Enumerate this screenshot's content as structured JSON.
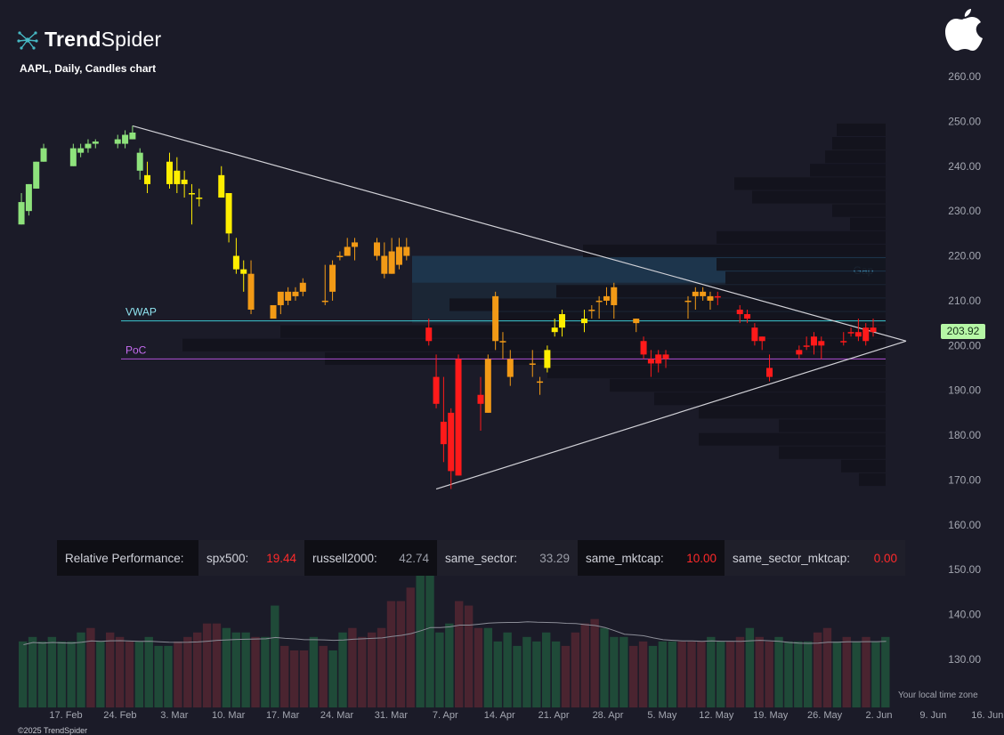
{
  "header": {
    "brand_bold": "Trend",
    "brand_light": "Spider",
    "subtitle": "AAPL, Daily, Candles chart",
    "copyright": "©2025 TrendSpider",
    "timezone_note": "Your local time zone"
  },
  "last_price": "203.92",
  "colors": {
    "background": "#1b1b28",
    "bull_strong": "#8ee27c",
    "neutral_yellow": "#ffee00",
    "bear_orange": "#f29a16",
    "bear_red": "#ff1a1a",
    "vwap": "#3cc8d2",
    "poc": "#b04fd6",
    "gap_zone": "#1f3f58",
    "trendline": "#d2d2d8",
    "volume_green": "#1f4a38",
    "volume_red": "#4a2430"
  },
  "performance": {
    "title": "Relative Performance:",
    "items": [
      {
        "label": "spx500:",
        "value": "19.44",
        "tone": "red",
        "bg": "light"
      },
      {
        "label": "russell2000:",
        "value": "42.74",
        "tone": "grey",
        "bg": "dark"
      },
      {
        "label": "same_sector:",
        "value": "33.29",
        "tone": "grey",
        "bg": "light"
      },
      {
        "label": "same_mktcap:",
        "value": "10.00",
        "tone": "red",
        "bg": "dark"
      },
      {
        "label": "same_sector_mktcap:",
        "value": "0.00",
        "tone": "red",
        "bg": "light"
      }
    ]
  },
  "chart_data": {
    "type": "candlestick",
    "symbol": "AAPL",
    "interval": "Daily",
    "y_axis": {
      "ticks": [
        "260.00",
        "250.00",
        "240.00",
        "230.00",
        "220.00",
        "210.00",
        "200.00",
        "190.00",
        "180.00",
        "170.00",
        "160.00",
        "150.00",
        "140.00",
        "130.00"
      ],
      "range": [
        130,
        260
      ]
    },
    "x_axis": {
      "ticks": [
        "17. Feb",
        "24. Feb",
        "3. Mar",
        "10. Mar",
        "17. Mar",
        "24. Mar",
        "31. Mar",
        "7. Apr",
        "14. Apr",
        "21. Apr",
        "28. Apr",
        "5. May",
        "12. May",
        "19. May",
        "26. May",
        "2. Jun",
        "9. Jun",
        "16. Jun"
      ]
    },
    "candles": [
      {
        "date": "2025-02-11",
        "o": 227,
        "h": 234,
        "l": 227,
        "c": 232,
        "col": "green"
      },
      {
        "date": "2025-02-12",
        "o": 230,
        "h": 236,
        "l": 229,
        "c": 236,
        "col": "green"
      },
      {
        "date": "2025-02-13",
        "o": 235,
        "h": 241,
        "l": 235,
        "c": 241,
        "col": "green"
      },
      {
        "date": "2025-02-14",
        "o": 241,
        "h": 245,
        "l": 241,
        "c": 244,
        "col": "green"
      },
      {
        "date": "2025-02-18",
        "o": 240,
        "h": 245,
        "l": 240,
        "c": 244,
        "col": "green"
      },
      {
        "date": "2025-02-19",
        "o": 243,
        "h": 245,
        "l": 242,
        "c": 244,
        "col": "green"
      },
      {
        "date": "2025-02-20",
        "o": 244,
        "h": 246,
        "l": 243,
        "c": 245,
        "col": "green"
      },
      {
        "date": "2025-02-21",
        "o": 245,
        "h": 246,
        "l": 244,
        "c": 245.5,
        "col": "green"
      },
      {
        "date": "2025-02-24",
        "o": 245,
        "h": 247,
        "l": 244,
        "c": 246,
        "col": "green"
      },
      {
        "date": "2025-02-25",
        "o": 245,
        "h": 248,
        "l": 244,
        "c": 247,
        "col": "green"
      },
      {
        "date": "2025-02-26",
        "o": 246,
        "h": 249,
        "l": 246,
        "c": 247.5,
        "col": "green"
      },
      {
        "date": "2025-02-27",
        "o": 243,
        "h": 244,
        "l": 237,
        "c": 239,
        "col": "green"
      },
      {
        "date": "2025-02-28",
        "o": 236,
        "h": 241,
        "l": 234,
        "c": 238,
        "col": "yellow"
      },
      {
        "date": "2025-03-03",
        "o": 241,
        "h": 243,
        "l": 235,
        "c": 236,
        "col": "yellow"
      },
      {
        "date": "2025-03-04",
        "o": 236,
        "h": 242,
        "l": 234,
        "c": 239,
        "col": "yellow"
      },
      {
        "date": "2025-03-05",
        "o": 237,
        "h": 239,
        "l": 233,
        "c": 236,
        "col": "yellow"
      },
      {
        "date": "2025-03-06",
        "o": 234,
        "h": 236,
        "l": 227,
        "c": 234,
        "col": "yellow"
      },
      {
        "date": "2025-03-07",
        "o": 233,
        "h": 235,
        "l": 231,
        "c": 233,
        "col": "yellow"
      },
      {
        "date": "2025-03-10",
        "o": 233,
        "h": 240,
        "l": 233,
        "c": 238,
        "col": "yellow"
      },
      {
        "date": "2025-03-11",
        "o": 234,
        "h": 234,
        "l": 223,
        "c": 225,
        "col": "yellow"
      },
      {
        "date": "2025-03-12",
        "o": 220,
        "h": 224,
        "l": 216,
        "c": 217,
        "col": "yellow"
      },
      {
        "date": "2025-03-13",
        "o": 217,
        "h": 219,
        "l": 212,
        "c": 216,
        "col": "yellow"
      },
      {
        "date": "2025-03-14",
        "o": 216,
        "h": 219,
        "l": 207,
        "c": 208,
        "col": "orange"
      },
      {
        "date": "2025-03-17",
        "o": 206,
        "h": 209,
        "l": 207,
        "c": 209,
        "col": "orange"
      },
      {
        "date": "2025-03-18",
        "o": 209,
        "h": 211,
        "l": 207,
        "c": 212,
        "col": "orange"
      },
      {
        "date": "2025-03-19",
        "o": 210,
        "h": 213,
        "l": 209,
        "c": 212,
        "col": "orange"
      },
      {
        "date": "2025-03-20",
        "o": 212,
        "h": 213,
        "l": 210,
        "c": 211,
        "col": "orange"
      },
      {
        "date": "2025-03-21",
        "o": 212,
        "h": 215,
        "l": 211,
        "c": 214,
        "col": "orange"
      },
      {
        "date": "2025-03-24",
        "o": 210,
        "h": 218,
        "l": 209,
        "c": 210,
        "col": "orange"
      },
      {
        "date": "2025-03-25",
        "o": 212,
        "h": 219,
        "l": 210,
        "c": 218,
        "col": "orange"
      },
      {
        "date": "2025-03-26",
        "o": 220,
        "h": 221,
        "l": 219,
        "c": 220,
        "col": "orange"
      },
      {
        "date": "2025-03-27",
        "o": 220,
        "h": 224,
        "l": 220,
        "c": 222,
        "col": "orange"
      },
      {
        "date": "2025-03-28",
        "o": 222,
        "h": 224,
        "l": 219,
        "c": 223,
        "col": "orange"
      },
      {
        "date": "2025-03-31",
        "o": 223,
        "h": 224,
        "l": 219,
        "c": 220,
        "col": "orange"
      },
      {
        "date": "2025-04-01",
        "o": 216,
        "h": 223,
        "l": 215,
        "c": 220,
        "col": "orange"
      },
      {
        "date": "2025-04-02",
        "o": 221,
        "h": 224,
        "l": 216,
        "c": 216,
        "col": "orange"
      },
      {
        "date": "2025-04-03",
        "o": 218,
        "h": 224,
        "l": 217,
        "c": 222,
        "col": "orange"
      },
      {
        "date": "2025-04-04",
        "o": 220,
        "h": 224,
        "l": 219,
        "c": 222,
        "col": "orange"
      },
      {
        "date": "2025-04-07",
        "o": 204,
        "h": 206,
        "l": 200,
        "c": 201,
        "col": "red"
      },
      {
        "date": "2025-04-08",
        "o": 193,
        "h": 198,
        "l": 186,
        "c": 187,
        "col": "red"
      },
      {
        "date": "2025-04-09",
        "o": 183,
        "h": 193,
        "l": 174,
        "c": 178,
        "col": "red"
      },
      {
        "date": "2025-04-10",
        "o": 185,
        "h": 186,
        "l": 168,
        "c": 172,
        "col": "red"
      },
      {
        "date": "2025-04-11",
        "o": 197,
        "h": 198,
        "l": 171,
        "c": 171,
        "col": "red"
      },
      {
        "date": "2025-04-14",
        "o": 189,
        "h": 193,
        "l": 181,
        "c": 187,
        "col": "red"
      },
      {
        "date": "2025-04-15",
        "o": 185,
        "h": 198,
        "l": 185,
        "c": 197,
        "col": "orange"
      },
      {
        "date": "2025-04-16",
        "o": 201,
        "h": 212,
        "l": 199,
        "c": 211,
        "col": "orange"
      },
      {
        "date": "2025-04-17",
        "o": 201,
        "h": 203,
        "l": 197,
        "c": 201,
        "col": "orange"
      },
      {
        "date": "2025-04-18",
        "o": 193,
        "h": 199,
        "l": 191,
        "c": 197,
        "col": "orange"
      },
      {
        "date": "2025-04-21",
        "o": 196,
        "h": 199,
        "l": 193,
        "c": 196,
        "col": "orange"
      },
      {
        "date": "2025-04-22",
        "o": 192,
        "h": 193,
        "l": 189,
        "c": 192,
        "col": "orange"
      },
      {
        "date": "2025-04-23",
        "o": 195,
        "h": 200,
        "l": 194,
        "c": 199,
        "col": "yellow"
      },
      {
        "date": "2025-04-24",
        "o": 203,
        "h": 206,
        "l": 202,
        "c": 204,
        "col": "yellow"
      },
      {
        "date": "2025-04-25",
        "o": 204,
        "h": 208,
        "l": 202,
        "c": 207,
        "col": "yellow"
      },
      {
        "date": "2025-04-28",
        "o": 206,
        "h": 208,
        "l": 203,
        "c": 205,
        "col": "yellow"
      },
      {
        "date": "2025-04-29",
        "o": 208,
        "h": 209,
        "l": 206,
        "c": 208,
        "col": "orange"
      },
      {
        "date": "2025-04-30",
        "o": 210,
        "h": 211,
        "l": 206,
        "c": 210,
        "col": "orange"
      },
      {
        "date": "2025-05-01",
        "o": 210,
        "h": 213,
        "l": 209,
        "c": 211,
        "col": "orange"
      },
      {
        "date": "2025-05-02",
        "o": 213,
        "h": 214,
        "l": 206,
        "c": 209,
        "col": "orange"
      },
      {
        "date": "2025-05-05",
        "o": 206,
        "h": 206,
        "l": 203,
        "c": 205,
        "col": "orange"
      },
      {
        "date": "2025-05-06",
        "o": 201,
        "h": 202,
        "l": 197,
        "c": 198,
        "col": "red"
      },
      {
        "date": "2025-05-07",
        "o": 197,
        "h": 199,
        "l": 193,
        "c": 196,
        "col": "red"
      },
      {
        "date": "2025-05-08",
        "o": 198,
        "h": 199,
        "l": 194,
        "c": 196,
        "col": "red"
      },
      {
        "date": "2025-05-09",
        "o": 198,
        "h": 199,
        "l": 195,
        "c": 197,
        "col": "red"
      },
      {
        "date": "2025-05-12",
        "o": 210,
        "h": 211,
        "l": 206,
        "c": 210,
        "col": "orange"
      },
      {
        "date": "2025-05-13",
        "o": 211,
        "h": 213,
        "l": 208,
        "c": 212,
        "col": "orange"
      },
      {
        "date": "2025-05-14",
        "o": 211,
        "h": 213,
        "l": 210,
        "c": 212,
        "col": "orange"
      },
      {
        "date": "2025-05-15",
        "o": 211,
        "h": 212,
        "l": 208,
        "c": 210,
        "col": "orange"
      },
      {
        "date": "2025-05-16",
        "o": 211,
        "h": 212,
        "l": 209,
        "c": 211,
        "col": "red"
      },
      {
        "date": "2025-05-19",
        "o": 208,
        "h": 209,
        "l": 205,
        "c": 207,
        "col": "red"
      },
      {
        "date": "2025-05-20",
        "o": 207,
        "h": 208,
        "l": 205,
        "c": 206,
        "col": "red"
      },
      {
        "date": "2025-05-21",
        "o": 204,
        "h": 205,
        "l": 200,
        "c": 201,
        "col": "red"
      },
      {
        "date": "2025-05-22",
        "o": 202,
        "h": 202,
        "l": 199,
        "c": 201,
        "col": "red"
      },
      {
        "date": "2025-05-23",
        "o": 193,
        "h": 198,
        "l": 192,
        "c": 195,
        "col": "red"
      },
      {
        "date": "2025-05-27",
        "o": 199,
        "h": 200,
        "l": 197,
        "c": 198,
        "col": "red"
      },
      {
        "date": "2025-05-28",
        "o": 200,
        "h": 202,
        "l": 199,
        "c": 200,
        "col": "red"
      },
      {
        "date": "2025-05-29",
        "o": 202,
        "h": 203,
        "l": 198,
        "c": 200,
        "col": "red"
      },
      {
        "date": "2025-05-30",
        "o": 201,
        "h": 202,
        "l": 197,
        "c": 200,
        "col": "red"
      },
      {
        "date": "2025-06-02",
        "o": 201,
        "h": 203,
        "l": 200,
        "c": 201,
        "col": "red"
      },
      {
        "date": "2025-06-03",
        "o": 203,
        "h": 204,
        "l": 202,
        "c": 203,
        "col": "red"
      },
      {
        "date": "2025-06-04",
        "o": 203,
        "h": 206,
        "l": 201,
        "c": 202,
        "col": "red"
      },
      {
        "date": "2025-06-05",
        "o": 204,
        "h": 205,
        "l": 200,
        "c": 201,
        "col": "red"
      },
      {
        "date": "2025-06-06",
        "o": 204,
        "h": 206,
        "l": 202,
        "c": 203,
        "col": "red"
      }
    ],
    "vwap": 205.5,
    "poc": 197.0,
    "gap_zone": [
      214,
      220
    ],
    "annotations": [
      "VWAP",
      "PoC",
      "Gap"
    ],
    "volume": {
      "baseline": 128,
      "values": [
        134,
        135,
        134,
        135,
        134,
        134,
        136,
        137,
        134,
        136,
        135,
        134,
        134,
        135,
        133,
        133,
        134,
        135,
        136,
        138,
        138,
        137,
        136,
        136,
        135,
        135,
        142,
        133,
        132,
        132,
        135,
        133,
        132,
        136,
        137,
        135,
        136,
        137,
        143,
        143,
        146,
        150,
        151,
        136,
        138,
        143,
        142,
        137,
        137,
        134,
        136,
        133,
        135,
        134,
        136,
        134,
        133,
        136,
        138,
        139,
        137,
        135,
        135,
        133,
        134,
        133,
        134,
        134,
        134,
        134,
        134,
        135,
        134,
        134,
        135,
        137,
        135,
        134,
        135,
        134,
        134,
        134,
        136,
        137,
        134,
        135,
        134,
        135,
        134,
        135
      ]
    },
    "volume_colors": [
      "g",
      "g",
      "g",
      "g",
      "g",
      "g",
      "g",
      "r",
      "g",
      "r",
      "r",
      "r",
      "g",
      "g",
      "g",
      "g",
      "r",
      "r",
      "r",
      "r",
      "r",
      "g",
      "g",
      "g",
      "r",
      "g",
      "g",
      "r",
      "r",
      "r",
      "g",
      "r",
      "g",
      "g",
      "r",
      "r",
      "r",
      "r",
      "r",
      "r",
      "r",
      "g",
      "g",
      "g",
      "g",
      "r",
      "r",
      "r",
      "g",
      "g",
      "g",
      "g",
      "g",
      "g",
      "g",
      "g",
      "r",
      "r",
      "r",
      "r",
      "g",
      "g",
      "g",
      "r",
      "r",
      "g",
      "g",
      "g",
      "r",
      "r",
      "r",
      "g",
      "g",
      "r",
      "r",
      "g",
      "r",
      "r",
      "g",
      "g",
      "g",
      "g",
      "r",
      "r",
      "g",
      "r",
      "g",
      "r",
      "g",
      "g"
    ],
    "volume_profile": [
      {
        "price": 248,
        "len": 55
      },
      {
        "price": 245,
        "len": 60
      },
      {
        "price": 242,
        "len": 68
      },
      {
        "price": 239,
        "len": 85
      },
      {
        "price": 236,
        "len": 170
      },
      {
        "price": 233,
        "len": 150
      },
      {
        "price": 230,
        "len": 60
      },
      {
        "price": 227,
        "len": 40
      },
      {
        "price": 224,
        "len": 190
      },
      {
        "price": 221,
        "len": 340
      },
      {
        "price": 218,
        "len": 190
      },
      {
        "price": 215,
        "len": 180
      },
      {
        "price": 212,
        "len": 370
      },
      {
        "price": 209,
        "len": 490
      },
      {
        "price": 206,
        "len": 440
      },
      {
        "price": 203,
        "len": 680
      },
      {
        "price": 200,
        "len": 790
      },
      {
        "price": 197,
        "len": 630
      },
      {
        "price": 194,
        "len": 380
      },
      {
        "price": 191,
        "len": 310
      },
      {
        "price": 188,
        "len": 260
      },
      {
        "price": 185,
        "len": 210
      },
      {
        "price": 182,
        "len": 120
      },
      {
        "price": 179,
        "len": 210
      },
      {
        "price": 176,
        "len": 120
      },
      {
        "price": 173,
        "len": 50
      },
      {
        "price": 170,
        "len": 30
      }
    ],
    "trend_lines": [
      {
        "from": [
          10,
          249
        ],
        "to": [
          96,
          201
        ]
      },
      {
        "from": [
          39,
          168
        ],
        "to": [
          96,
          201
        ]
      }
    ]
  }
}
